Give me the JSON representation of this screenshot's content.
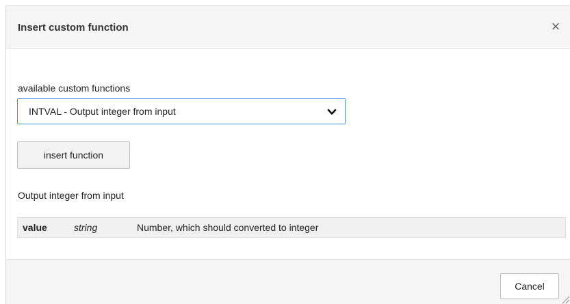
{
  "dialog": {
    "title": "Insert custom function",
    "close_icon": "close-icon",
    "close_glyph": "×"
  },
  "form": {
    "select_label": "available custom functions",
    "selected_function": "INTVAL - Output integer from input",
    "chevron_icon": "chevron-down-icon",
    "insert_button_label": "insert function",
    "function_description": "Output integer from input",
    "parameters": [
      {
        "name": "value",
        "type": "string",
        "description": "Number, which should converted to integer"
      }
    ]
  },
  "footer": {
    "cancel_label": "Cancel",
    "resize_icon": "resize-grip-icon"
  },
  "colors": {
    "accent": "#4a90e2",
    "header_bg": "#f5f5f5",
    "param_bg": "#f0f0f0"
  }
}
